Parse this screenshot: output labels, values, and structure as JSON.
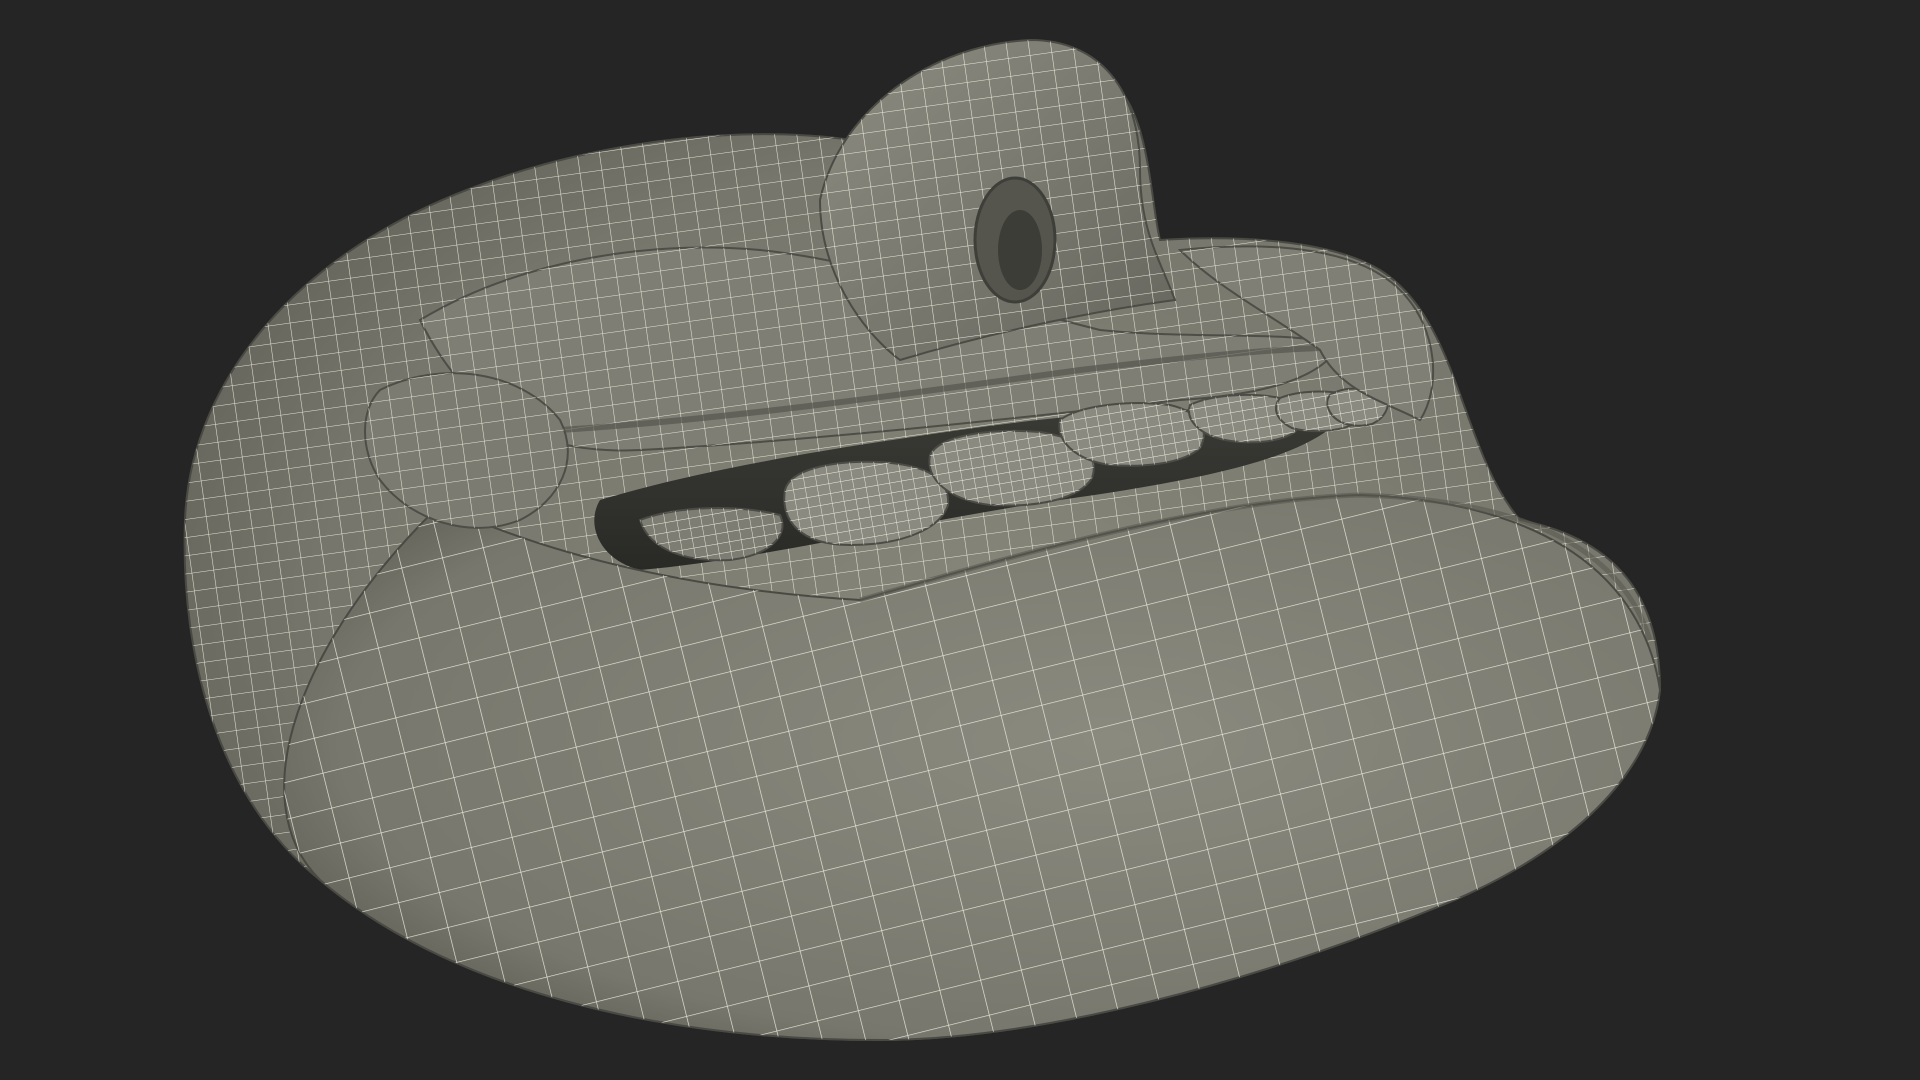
{
  "scene": {
    "subject": "lips-mouth-wireframe-model",
    "colors": {
      "background": "#252525",
      "surface": "#7a7a70",
      "surface_light": "#8d8d83",
      "surface_dark": "#55554d",
      "cavity": "#2f2f2b",
      "wire": "#f2f0e2",
      "teeth": "#85857b"
    }
  }
}
